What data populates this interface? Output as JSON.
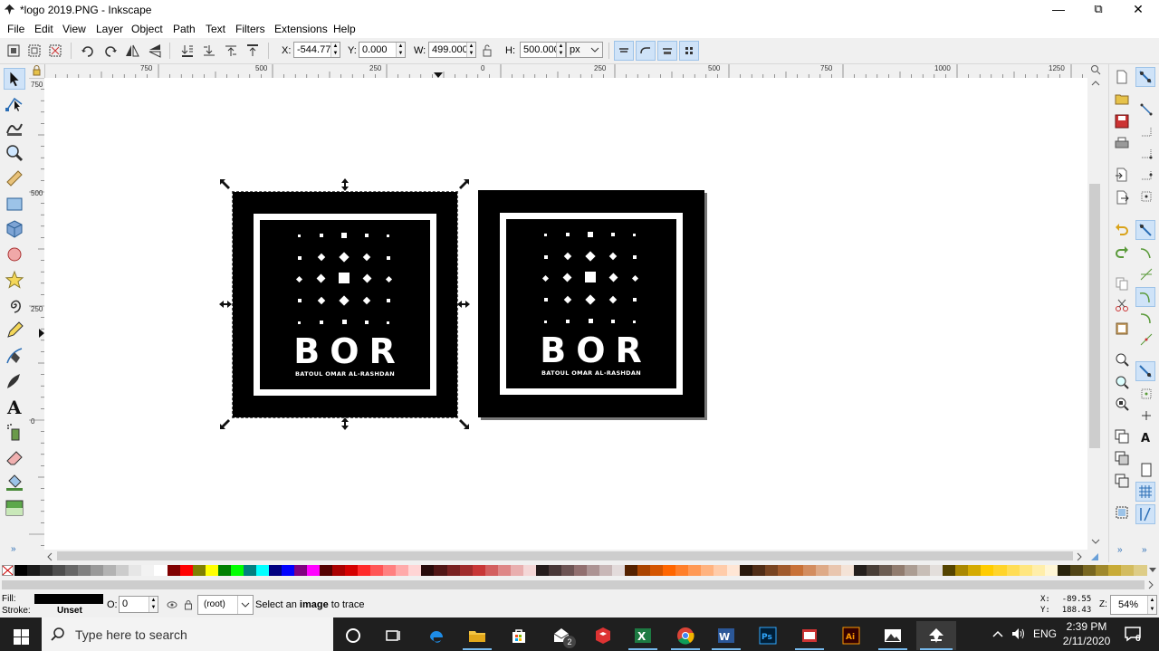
{
  "window": {
    "title": "*logo 2019.PNG - Inkscape",
    "controls": {
      "minimize": "—",
      "maximize": "⧉",
      "close": "✕"
    }
  },
  "menu": [
    "File",
    "Edit",
    "View",
    "Layer",
    "Object",
    "Path",
    "Text",
    "Filters",
    "Extensions",
    "Help"
  ],
  "toolctrl": {
    "x_label": "X:",
    "x_value": "-544.77",
    "y_label": "Y:",
    "y_value": "0.000",
    "w_label": "W:",
    "w_value": "499.000",
    "h_label": "H:",
    "h_value": "500.000",
    "unit": "px"
  },
  "hruler": {
    "labels": [
      "750",
      "500",
      "250",
      "0",
      "250",
      "500",
      "750",
      "1000",
      "1250"
    ]
  },
  "vruler": {
    "labels": [
      "750",
      "500",
      "250",
      "0"
    ]
  },
  "logo": {
    "brand": "BOR",
    "tagline": "BATOUL OMAR AL-RASHDAN"
  },
  "palette": {
    "colors": [
      "#000000",
      "#1a1a1a",
      "#333333",
      "#4d4d4d",
      "#666666",
      "#808080",
      "#999999",
      "#b3b3b3",
      "#cccccc",
      "#e6e6e6",
      "#f2f2f2",
      "#ffffff",
      "#800000",
      "#ff0000",
      "#808000",
      "#ffff00",
      "#008000",
      "#00ff00",
      "#008080",
      "#00ffff",
      "#000080",
      "#0000ff",
      "#800080",
      "#ff00ff",
      "#550000",
      "#aa0000",
      "#d40000",
      "#ff2a2a",
      "#ff5555",
      "#ff8080",
      "#ffaaaa",
      "#ffd5d5",
      "#280b0b",
      "#501616",
      "#782121",
      "#a02c2c",
      "#c83737",
      "#d35f5f",
      "#de8787",
      "#e9afaf",
      "#f4d7d7",
      "#241c1c",
      "#483737",
      "#6c5353",
      "#916f6f",
      "#ac9393",
      "#c8b7b7",
      "#e3dbdb",
      "#552200",
      "#aa4400",
      "#d45500",
      "#ff6600",
      "#ff7f2a",
      "#ff9955",
      "#ffb380",
      "#ffccaa",
      "#ffe6d5",
      "#28170b",
      "#502d16",
      "#784421",
      "#a05a2c",
      "#c87137",
      "#d38d5f",
      "#deaa87",
      "#e9c6af",
      "#f4e3d7",
      "#241f1c",
      "#483e37",
      "#6c5d53",
      "#917c6f",
      "#ac9d93",
      "#c8beb7",
      "#e3dedb",
      "#554400",
      "#aa8800",
      "#d4aa00",
      "#ffcc00",
      "#ffd42a",
      "#ffdd55",
      "#ffe680",
      "#ffeeaa",
      "#fff6d5",
      "#28220b",
      "#504416",
      "#786721",
      "#a0892c",
      "#c8ab37",
      "#d3bc5f",
      "#decd87"
    ]
  },
  "status": {
    "fill_label": "Fill:",
    "stroke_label": "Stroke:",
    "stroke_value": "Unset",
    "opacity_label": "O:",
    "opacity_value": "0",
    "layer_value": "(root)",
    "message_pre": "Select an ",
    "message_bold": "image",
    "message_post": " to trace",
    "cursor_x_label": "X:",
    "cursor_x": "-89.55",
    "cursor_y_label": "Y:",
    "cursor_y": "188.43",
    "zoom_label": "Z:",
    "zoom_value": "54%"
  },
  "taskbar": {
    "search_placeholder": "Type here to search",
    "time": "2:39 PM",
    "date": "2/11/2020",
    "language": "ENG",
    "mail_badge": "2",
    "notification_count": "6"
  },
  "colors": {
    "selection_highlight": "#cfe3f8",
    "taskbar_bg": "#1f1f1f",
    "logo_bg": "#000000"
  }
}
